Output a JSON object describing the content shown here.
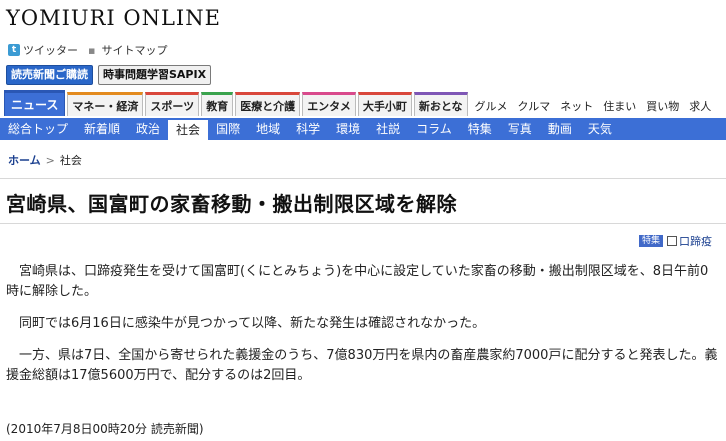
{
  "site": {
    "logo": "YOMIURI ONLINE",
    "links": [
      "ツイッター",
      "サイトマップ"
    ],
    "buttons": [
      "読売新聞ご購読",
      "時事問題学習SAPIX"
    ]
  },
  "category_tabs": [
    {
      "label": "ニュース",
      "style": "active"
    },
    {
      "label": "マネー・経済",
      "style": "orange"
    },
    {
      "label": "スポーツ",
      "style": "red"
    },
    {
      "label": "教育",
      "style": "green"
    },
    {
      "label": "医療と介護",
      "style": "red"
    },
    {
      "label": "エンタメ",
      "style": "pink"
    },
    {
      "label": "大手小町",
      "style": "red"
    },
    {
      "label": "新おとな",
      "style": "purple"
    }
  ],
  "category_plain": [
    "グルメ",
    "クルマ",
    "ネット",
    "住まい",
    "買い物",
    "求人"
  ],
  "nav": [
    "総合トップ",
    "新着順",
    "政治",
    "社会",
    "国際",
    "地域",
    "科学",
    "環境",
    "社説",
    "コラム",
    "特集",
    "写真",
    "動画",
    "天気"
  ],
  "nav_active": "社会",
  "breadcrumb": {
    "home": "ホーム",
    "current": "社会"
  },
  "headline": "宮崎県、国富町の家畜移動・搬出制限区域を解除",
  "topic": {
    "badge": "特集",
    "label": "口蹄疫"
  },
  "paragraphs": [
    "宮崎県は、口蹄疫発生を受けて国富町(くにとみちょう)を中心に設定していた家畜の移動・搬出制限区域を、8日午前0時に解除した。",
    "同町では6月16日に感染牛が見つかって以降、新たな発生は確認されなかった。",
    "一方、県は7日、全国から寄せられた義援金のうち、7億830万円を県内の畜産農家約7000戸に配分すると発表した。義援金総額は17億5600万円で、配分するのは2回目。"
  ],
  "dateline": "(2010年7月8日00時20分  読売新聞)"
}
